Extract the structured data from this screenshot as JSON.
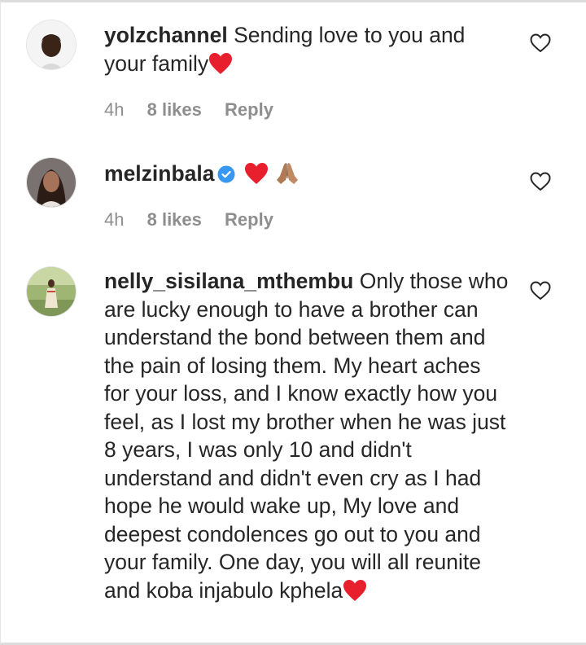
{
  "comments": [
    {
      "username": "yolzchannel",
      "text": "Sending love to you and your family",
      "time": "4h",
      "likes": "8 likes",
      "reply": "Reply"
    },
    {
      "username": "melzinbala",
      "verified": true,
      "text": "",
      "time": "4h",
      "likes": "8 likes",
      "reply": "Reply"
    },
    {
      "username": "nelly_sisilana_mthembu",
      "text": "Only those who are lucky enough to have a brother can understand the bond between them and the pain of losing them. My heart aches for your loss, and I know exactly how you feel, as I lost my brother when he was just 8 years, I was only 10 and didn't understand and didn't even cry as I had hope he would wake up, My love and deepest condolences go out to you and your family. One day, you will all reunite and koba injabulo kphela"
    }
  ],
  "icons": {
    "like": "heart-outline-icon",
    "verified": "verified-badge-icon",
    "emoji_heart": "red-heart-emoji",
    "emoji_pray": "folded-hands-emoji"
  },
  "colors": {
    "text": "#262626",
    "meta": "#8e8e8e",
    "verified": "#3897f0",
    "heart": "#e8202e"
  }
}
